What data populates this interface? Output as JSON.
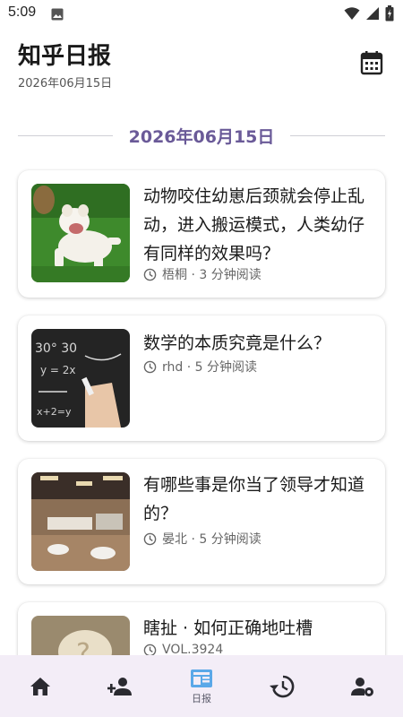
{
  "status_bar": {
    "time": "5:09"
  },
  "header": {
    "title": "知乎日报",
    "date": "2026年06月15日"
  },
  "divider": {
    "date": "2026年06月15日"
  },
  "stories": [
    {
      "title": "动物咬住幼崽后颈就会停止乱动，进入搬运模式，人类幼仔有同样的效果吗？",
      "meta": "梧桐 · 3 分钟阅读"
    },
    {
      "title": "数学的本质究竟是什么？",
      "meta": "rhd · 5 分钟阅读"
    },
    {
      "title": "有哪些事是你当了领导才知道的？",
      "meta": "晏北 · 5 分钟阅读"
    },
    {
      "title": "瞎扯 · 如何正确地吐槽",
      "meta": "VOL.3924"
    }
  ],
  "bottom_nav": {
    "items": [
      {
        "icon": "home-icon",
        "label": ""
      },
      {
        "icon": "person-add-icon",
        "label": ""
      },
      {
        "icon": "daily-icon",
        "label": "日报",
        "active": true
      },
      {
        "icon": "history-icon",
        "label": ""
      },
      {
        "icon": "account-settings-icon",
        "label": ""
      }
    ]
  },
  "colors": {
    "accent": "#6a5a98",
    "nav_bg": "#f3edf7",
    "active_icon": "#5aa8e8"
  }
}
